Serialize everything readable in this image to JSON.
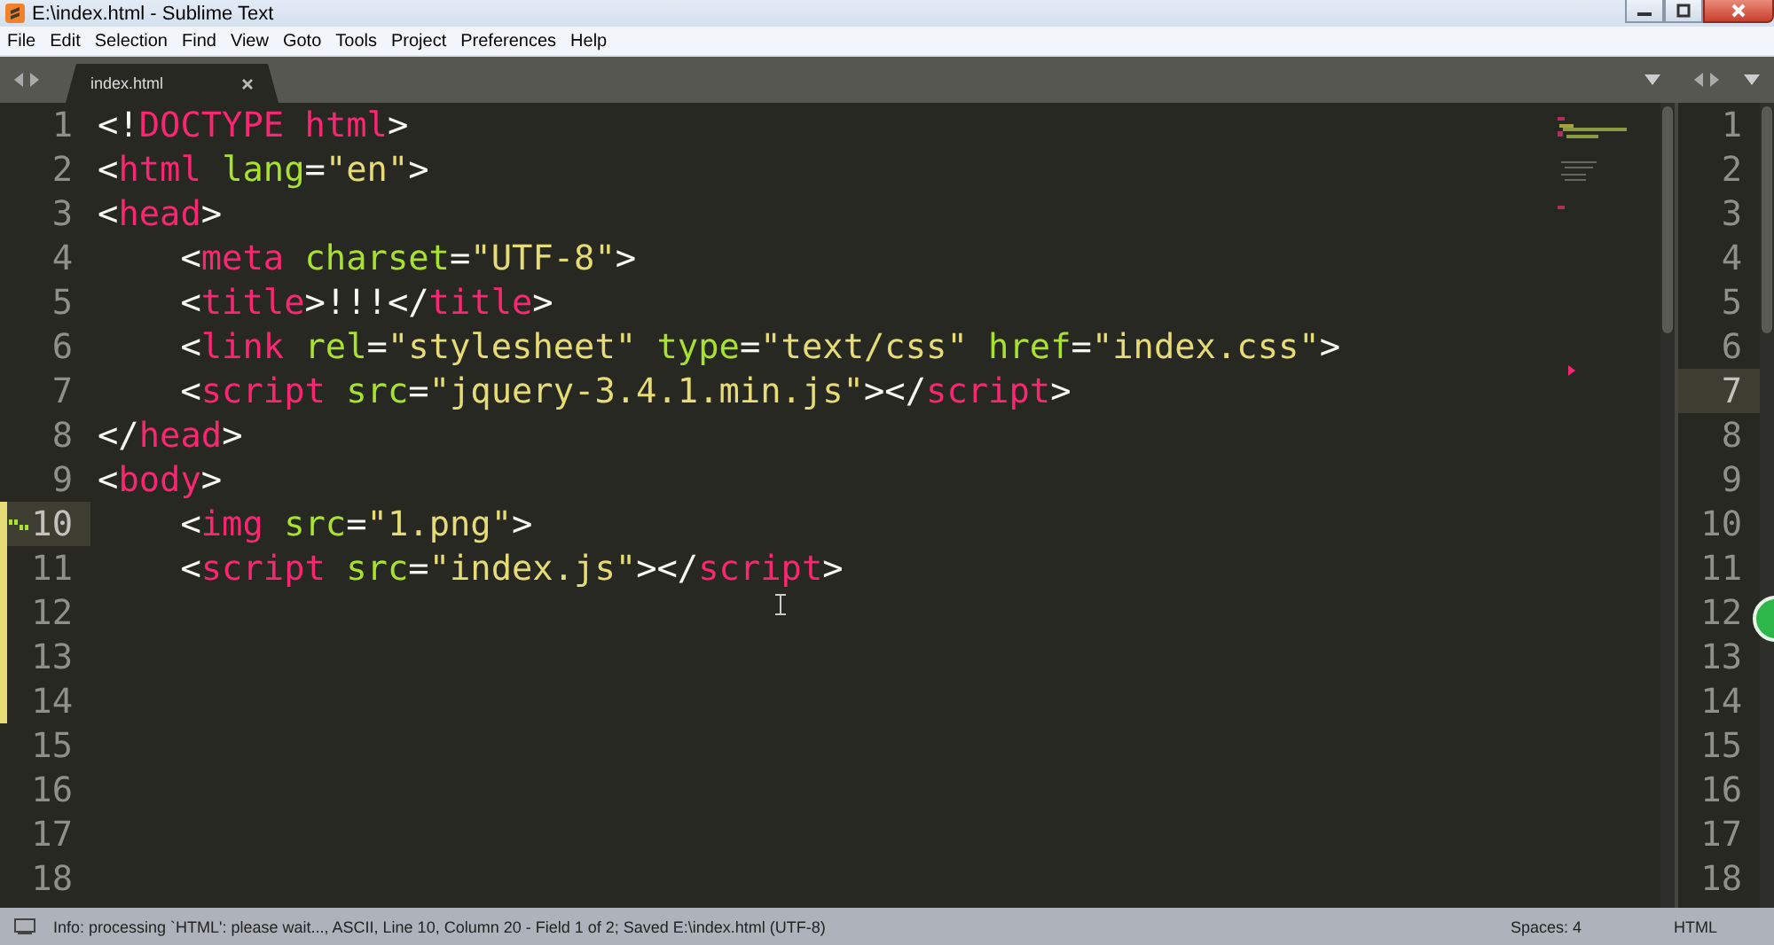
{
  "window": {
    "title": "E:\\index.html - Sublime Text"
  },
  "menu": [
    "File",
    "Edit",
    "Selection",
    "Find",
    "View",
    "Goto",
    "Tools",
    "Project",
    "Preferences",
    "Help"
  ],
  "tabs": [
    {
      "label": "index.html",
      "selected": true
    }
  ],
  "editor": {
    "lines": [
      {
        "number": "1",
        "current": false,
        "modified": false,
        "gutter_icon": false,
        "tokens": [
          {
            "kind": "punct",
            "text": "<!"
          },
          {
            "kind": "tag",
            "text": "DOCTYPE"
          },
          {
            "kind": "tag",
            "text": " html"
          },
          {
            "kind": "punct",
            "text": ">"
          }
        ]
      },
      {
        "number": "2",
        "current": false,
        "modified": false,
        "gutter_icon": false,
        "tokens": [
          {
            "kind": "punct",
            "text": "<"
          },
          {
            "kind": "tag",
            "text": "html"
          },
          {
            "kind": "attr",
            "text": " lang"
          },
          {
            "kind": "punct",
            "text": "="
          },
          {
            "kind": "string",
            "text": "\"en\""
          },
          {
            "kind": "punct",
            "text": ">"
          }
        ]
      },
      {
        "number": "3",
        "current": false,
        "modified": false,
        "gutter_icon": false,
        "tokens": [
          {
            "kind": "punct",
            "text": "<"
          },
          {
            "kind": "tag",
            "text": "head"
          },
          {
            "kind": "punct",
            "text": ">"
          }
        ]
      },
      {
        "number": "4",
        "current": false,
        "modified": false,
        "gutter_icon": false,
        "tokens": [
          {
            "kind": "punct",
            "text": "    <"
          },
          {
            "kind": "tag",
            "text": "meta"
          },
          {
            "kind": "attr",
            "text": " charset"
          },
          {
            "kind": "punct",
            "text": "="
          },
          {
            "kind": "string",
            "text": "\"UTF-8\""
          },
          {
            "kind": "punct",
            "text": ">"
          }
        ]
      },
      {
        "number": "5",
        "current": false,
        "modified": false,
        "gutter_icon": false,
        "tokens": [
          {
            "kind": "punct",
            "text": "    <"
          },
          {
            "kind": "tag",
            "text": "title"
          },
          {
            "kind": "punct",
            "text": ">!!!</"
          },
          {
            "kind": "tag",
            "text": "title"
          },
          {
            "kind": "punct",
            "text": ">"
          }
        ]
      },
      {
        "number": "6",
        "current": false,
        "modified": false,
        "gutter_icon": false,
        "tokens": [
          {
            "kind": "punct",
            "text": "    <"
          },
          {
            "kind": "tag",
            "text": "link"
          },
          {
            "kind": "attr",
            "text": " rel"
          },
          {
            "kind": "punct",
            "text": "="
          },
          {
            "kind": "string",
            "text": "\"stylesheet\""
          },
          {
            "kind": "attr",
            "text": " type"
          },
          {
            "kind": "punct",
            "text": "="
          },
          {
            "kind": "string",
            "text": "\"text/css\""
          },
          {
            "kind": "attr",
            "text": " href"
          },
          {
            "kind": "punct",
            "text": "="
          },
          {
            "kind": "string",
            "text": "\"index.css\""
          },
          {
            "kind": "punct",
            "text": ">"
          }
        ]
      },
      {
        "number": "7",
        "current": false,
        "modified": false,
        "gutter_icon": false,
        "tokens": [
          {
            "kind": "punct",
            "text": "    <"
          },
          {
            "kind": "tag",
            "text": "script"
          },
          {
            "kind": "attr",
            "text": " src"
          },
          {
            "kind": "punct",
            "text": "="
          },
          {
            "kind": "string",
            "text": "\"jquery-3.4.1.min.js\""
          },
          {
            "kind": "punct",
            "text": "></"
          },
          {
            "kind": "tag",
            "text": "script"
          },
          {
            "kind": "punct",
            "text": ">"
          }
        ]
      },
      {
        "number": "8",
        "current": false,
        "modified": false,
        "gutter_icon": false,
        "tokens": [
          {
            "kind": "punct",
            "text": "</"
          },
          {
            "kind": "tag",
            "text": "head"
          },
          {
            "kind": "punct",
            "text": ">"
          }
        ]
      },
      {
        "number": "9",
        "current": false,
        "modified": false,
        "gutter_icon": false,
        "tokens": [
          {
            "kind": "punct",
            "text": "<"
          },
          {
            "kind": "tag",
            "text": "body"
          },
          {
            "kind": "punct",
            "text": ">"
          }
        ]
      },
      {
        "number": "10",
        "current": true,
        "modified": true,
        "gutter_icon": true,
        "tokens": [
          {
            "kind": "punct",
            "text": "    <"
          },
          {
            "kind": "tag",
            "text": "img"
          },
          {
            "kind": "attr",
            "text": " src"
          },
          {
            "kind": "punct",
            "text": "="
          },
          {
            "kind": "string",
            "text": "\"1.png\""
          },
          {
            "kind": "punct",
            "text": ">"
          }
        ]
      },
      {
        "number": "11",
        "current": false,
        "modified": true,
        "gutter_icon": false,
        "tokens": [
          {
            "kind": "punct",
            "text": "    <"
          },
          {
            "kind": "tag",
            "text": "script"
          },
          {
            "kind": "attr",
            "text": " src"
          },
          {
            "kind": "punct",
            "text": "="
          },
          {
            "kind": "string",
            "text": "\"index.js\""
          },
          {
            "kind": "punct",
            "text": "></"
          },
          {
            "kind": "tag",
            "text": "script"
          },
          {
            "kind": "punct",
            "text": ">"
          }
        ]
      },
      {
        "number": "12",
        "current": false,
        "modified": true,
        "gutter_icon": false
      },
      {
        "number": "13",
        "current": false,
        "modified": true,
        "gutter_icon": false
      },
      {
        "number": "14",
        "current": false,
        "modified": true,
        "gutter_icon": false
      },
      {
        "number": "15",
        "current": false,
        "modified": false,
        "gutter_icon": false
      },
      {
        "number": "16",
        "current": false,
        "modified": false,
        "gutter_icon": false
      },
      {
        "number": "17",
        "current": false,
        "modified": false,
        "gutter_icon": false
      },
      {
        "number": "18",
        "current": false,
        "modified": false,
        "gutter_icon": false
      }
    ]
  },
  "split_view": {
    "lines": [
      {
        "number": "1",
        "current": false
      },
      {
        "number": "2",
        "current": false
      },
      {
        "number": "3",
        "current": false
      },
      {
        "number": "4",
        "current": false
      },
      {
        "number": "5",
        "current": false
      },
      {
        "number": "6",
        "current": false
      },
      {
        "number": "7",
        "current": true
      },
      {
        "number": "8",
        "current": false
      },
      {
        "number": "9",
        "current": false
      },
      {
        "number": "10",
        "current": false
      },
      {
        "number": "11",
        "current": false
      },
      {
        "number": "12",
        "current": false
      },
      {
        "number": "13",
        "current": false
      },
      {
        "number": "14",
        "current": false
      },
      {
        "number": "15",
        "current": false
      },
      {
        "number": "16",
        "current": false
      },
      {
        "number": "17",
        "current": false
      },
      {
        "number": "18",
        "current": false
      }
    ]
  },
  "status_bar": {
    "message": "Info: processing `HTML': please wait..., ASCII, Line 10, Column 20 - Field 1 of 2; Saved E:\\index.html (UTF-8)",
    "indentation": "Spaces: 4",
    "syntax": "HTML"
  }
}
